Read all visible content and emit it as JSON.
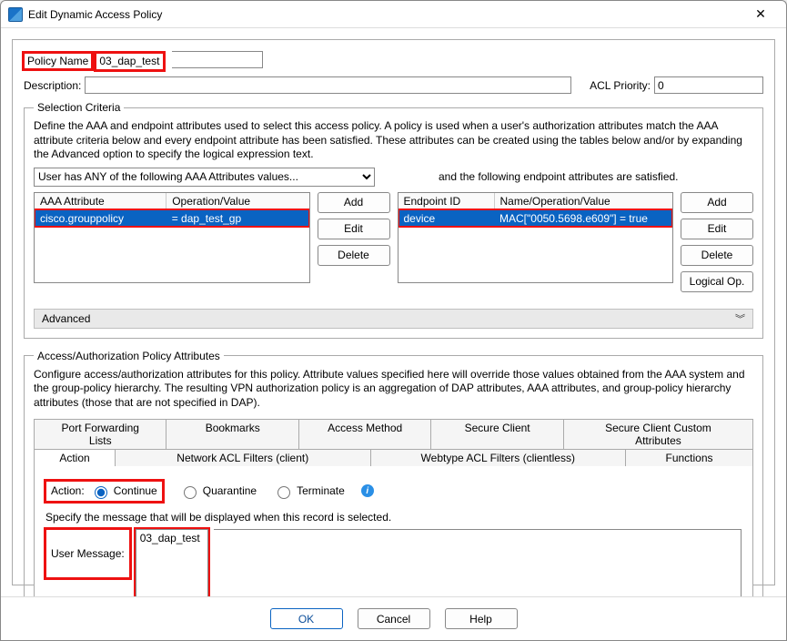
{
  "window": {
    "title": "Edit Dynamic Access Policy"
  },
  "fields": {
    "policy_name_label": "Policy Name",
    "policy_name_value": "03_dap_test",
    "description_label": "Description:",
    "description_value": "",
    "acl_priority_label": "ACL Priority:",
    "acl_priority_value": "0"
  },
  "selection": {
    "legend": "Selection Criteria",
    "desc": "Define the AAA and endpoint attributes used to select this access policy. A policy is used when a user's authorization attributes match the AAA attribute criteria below and every endpoint attribute has been satisfied. These attributes can be created using the tables below and/or by expanding the Advanced option to specify the logical expression text.",
    "combo": "User has ANY of the following AAA Attributes values...",
    "endpoint_label": "and the following endpoint attributes are satisfied.",
    "aaa_headers": {
      "col1": "AAA Attribute",
      "col2": "Operation/Value"
    },
    "aaa_rows": [
      {
        "attr": "cisco.grouppolicy",
        "op": "=   dap_test_gp"
      }
    ],
    "ep_headers": {
      "col1": "Endpoint ID",
      "col2": "Name/Operation/Value"
    },
    "ep_rows": [
      {
        "id": "device",
        "val": "MAC[\"0050.5698.e609\"]  =  true"
      }
    ],
    "buttons": {
      "add": "Add",
      "edit": "Edit",
      "delete": "Delete",
      "logical": "Logical Op."
    },
    "advanced": "Advanced"
  },
  "policy": {
    "legend": "Access/Authorization Policy Attributes",
    "desc": "Configure access/authorization attributes for this policy. Attribute values specified here will override those values obtained from the AAA system and the group-policy hierarchy. The resulting VPN authorization policy is an aggregation of DAP attributes, AAA attributes, and group-policy hierarchy attributes (those that are not specified in DAP).",
    "tabs_row1": [
      "Port Forwarding Lists",
      "Bookmarks",
      "Access Method",
      "Secure Client",
      "Secure Client Custom Attributes"
    ],
    "tabs_row2": [
      "Action",
      "Network ACL Filters (client)",
      "Webtype ACL Filters (clientless)",
      "Functions"
    ],
    "action_label": "Action:",
    "radios": {
      "continue": "Continue",
      "quarantine": "Quarantine",
      "terminate": "Terminate"
    },
    "msg_hint": "Specify the message that will be displayed when this record is selected.",
    "user_message_label": "User Message:",
    "user_message_value": "03_dap_test"
  },
  "footer": {
    "ok": "OK",
    "cancel": "Cancel",
    "help": "Help"
  }
}
